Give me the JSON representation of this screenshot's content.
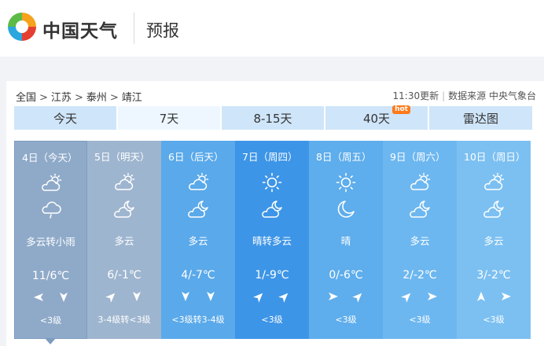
{
  "brand": {
    "name": "中国天气",
    "section": "预报"
  },
  "breadcrumb": [
    "全国",
    "江苏",
    "泰州",
    "靖江"
  ],
  "meta": {
    "update_time": "11:30更新",
    "source": "数据来源 中央气象台"
  },
  "tabs": [
    {
      "label": "今天",
      "active": false
    },
    {
      "label": "7天",
      "active": true
    },
    {
      "label": "8-15天",
      "active": false
    },
    {
      "label": "40天",
      "active": false,
      "badge": "hot"
    },
    {
      "label": "雷达图",
      "active": false
    }
  ],
  "days": [
    {
      "date": "4日（今天）",
      "icon_day": "cloudy-sun-icon",
      "icon_night": "light-rain-icon",
      "desc": "多云转小雨",
      "temp": "11/6℃",
      "wind": [
        "arrow-left-icon",
        "arrow-down-icon"
      ],
      "level": "<3级",
      "bg": "#8faac9"
    },
    {
      "date": "5日（明天）",
      "icon_day": "cloudy-sun-icon",
      "icon_night": "cloudy-moon-icon",
      "desc": "多云",
      "temp": "6/-1℃",
      "wind": [
        "arrow-up-right-icon",
        "arrow-down-icon"
      ],
      "level": "3-4级转<3级",
      "bg": "#9eb5cf"
    },
    {
      "date": "6日（后天）",
      "icon_day": "cloudy-sun-icon",
      "icon_night": "cloudy-moon-icon",
      "desc": "多云",
      "temp": "4/-7℃",
      "wind": [
        "arrow-down-icon",
        "arrow-down-icon"
      ],
      "level": "<3级转3-4级",
      "bg": "#5aa9ea"
    },
    {
      "date": "7日（周四）",
      "icon_day": "sun-icon",
      "icon_night": "cloudy-moon-icon",
      "desc": "晴转多云",
      "temp": "1/-9℃",
      "wind": [
        "arrow-up-right-icon",
        "arrow-up-right-icon"
      ],
      "level": "<3级",
      "bg": "#3d95e7"
    },
    {
      "date": "8日（周五）",
      "icon_day": "sun-icon",
      "icon_night": "moon-icon",
      "desc": "晴",
      "temp": "0/-6℃",
      "wind": [
        "arrow-right-icon",
        "arrow-up-right-icon"
      ],
      "level": "<3级",
      "bg": "#5eadec"
    },
    {
      "date": "9日（周六）",
      "icon_day": "cloudy-sun-icon",
      "icon_night": "cloudy-moon-icon",
      "desc": "多云",
      "temp": "2/-2℃",
      "wind": [
        "arrow-up-right-icon",
        "arrow-right-icon"
      ],
      "level": "<3级",
      "bg": "#6db7f0"
    },
    {
      "date": "10日（周日）",
      "icon_day": "cloudy-sun-icon",
      "icon_night": "cloudy-moon-icon",
      "desc": "多云",
      "temp": "3/-2℃",
      "wind": [
        "arrow-up-icon",
        "arrow-right-icon"
      ],
      "level": "<3级",
      "bg": "#7cc0f2"
    }
  ]
}
